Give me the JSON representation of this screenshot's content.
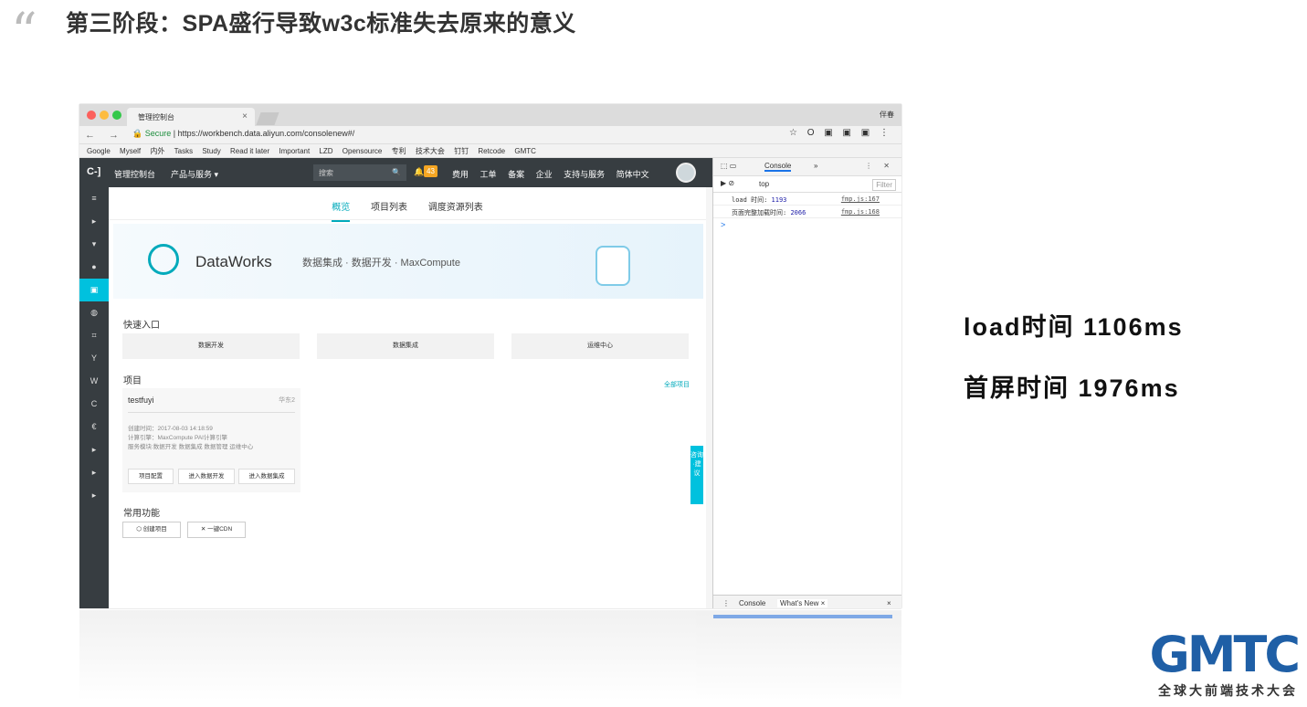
{
  "slide": {
    "quote_mark": "“",
    "title": "第三阶段：SPA盛行导致w3c标准失去原来的意义",
    "metric_load": "load时间 1106ms",
    "metric_first_screen": "首屏时间  1976ms",
    "logo": "GMTC",
    "logo_sub": "全球大前端技术大会"
  },
  "browser": {
    "tab_title": "管理控制台",
    "tab_close": "×",
    "profile": "伴春",
    "nav_icons": "← → ✕",
    "secure_label": "Secure",
    "url": "https://workbench.data.aliyun.com/consolenew#/",
    "bookmarks": [
      "Google",
      "Myself",
      "内外",
      "Tasks",
      "Study",
      "Read it later",
      "Important",
      "LZD",
      "Opensource",
      "专利",
      "技术大会",
      "钉钉",
      "Retcode",
      "GMTC"
    ]
  },
  "app": {
    "logo": "C-]",
    "console": "管理控制台",
    "products": "产品与服务 ▾",
    "search_placeholder": "搜索",
    "notif_count": "43",
    "nav": [
      "费用",
      "工单",
      "备案",
      "企业",
      "支持与服务",
      "简体中文"
    ],
    "tabs": [
      "概览",
      "项目列表",
      "调度资源列表"
    ],
    "banner_title": "DataWorks",
    "banner_sub": "数据集成 · 数据开发 · MaxCompute",
    "quick_entry": "快速入口",
    "quick_buttons": [
      "数据开发",
      "数据集成",
      "运维中心"
    ],
    "projects": "项目",
    "all_projects": "全部项目",
    "project_name": "testfuyi",
    "project_region": "华东2",
    "project_info": [
      "创建时间：2017-08-03 14:18:59",
      "计算引擎：MaxCompute PAI计算引擎",
      "服务模块:数据开发 数据集成 数据管理 运维中心"
    ],
    "project_buttons": [
      "项目配置",
      "进入数据开发",
      "进入数据集成"
    ],
    "common": "常用功能",
    "func_buttons": [
      "创建项目",
      "一键CDN"
    ],
    "consult": "咨询·建议"
  },
  "devtools": {
    "console_tab": "Console",
    "more": "»",
    "context": "top",
    "filter": "Filter",
    "logs": [
      {
        "label": "load 时间:",
        "value": "1193",
        "src": "fmp.js:167"
      },
      {
        "label": "页面完整加载时间:",
        "value": "2066",
        "src": "fmp.js:168"
      }
    ],
    "prompt": ">",
    "drawer_console": "Console",
    "drawer_whatsnew": "What's New ×",
    "drawer_close": "×"
  }
}
